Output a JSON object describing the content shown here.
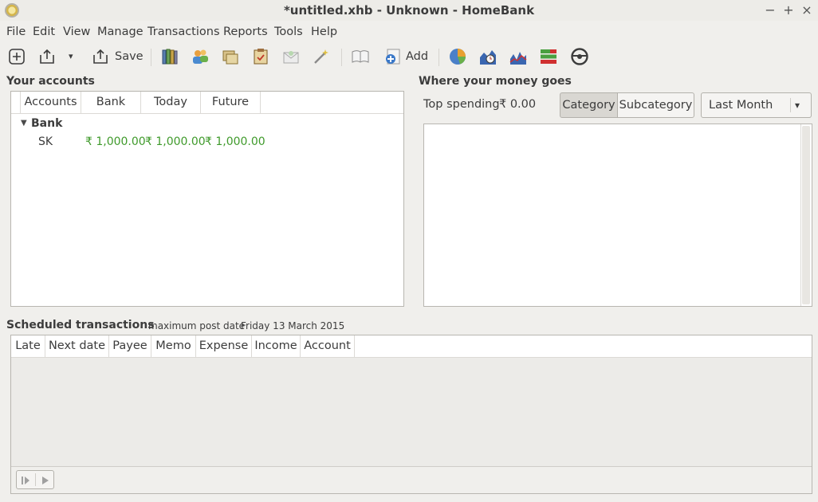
{
  "window": {
    "title": "*untitled.xhb - Unknown - HomeBank",
    "minimize_glyph": "−",
    "maximize_glyph": "+",
    "close_glyph": "×"
  },
  "menu": [
    "File",
    "Edit",
    "View",
    "Manage",
    "Transactions",
    "Reports",
    "Tools",
    "Help"
  ],
  "toolbar": {
    "save_label": "Save",
    "add_label": "Add",
    "dropdown_glyph": "▾",
    "icons": [
      "new-file-icon",
      "open-file-icon",
      "save-icon",
      "accounts-icon",
      "payees-icon",
      "categories-icon",
      "archives-icon",
      "budget-icon",
      "import-icon",
      "assistant-icon",
      "show-register-icon",
      "add-transaction-icon",
      "statistics-report-icon",
      "trend-report-icon",
      "balance-report-icon",
      "budget-report-icon",
      "car-cost-icon"
    ]
  },
  "accounts": {
    "title": "Your accounts",
    "columns": [
      "Accounts",
      "Bank",
      "Today",
      "Future"
    ],
    "groups": [
      {
        "name": "Bank",
        "expander_glyph": "▼",
        "rows": [
          {
            "name": "SK",
            "bank": "₹ 1,000.00",
            "today": "₹ 1,000.00",
            "future": "₹ 1,000.00"
          }
        ]
      }
    ],
    "amount_color": "#3f9a2b"
  },
  "spending": {
    "title": "Where your money goes",
    "top_spending_label": "Top spending",
    "top_spending_value": "₹ 0.00",
    "toggle": [
      "Category",
      "Subcategory"
    ],
    "selected_toggle": "Category",
    "period": "Last Month",
    "period_arrow": "▾"
  },
  "scheduled": {
    "title": "Scheduled transactions",
    "max_post_label": "maximum post date",
    "max_post_date": "Friday 13 March 2015",
    "columns": [
      "Late",
      "Next date",
      "Payee",
      "Memo",
      "Expense",
      "Income",
      "Account"
    ],
    "footer_buttons": [
      "skip-icon",
      "post-icon"
    ]
  }
}
